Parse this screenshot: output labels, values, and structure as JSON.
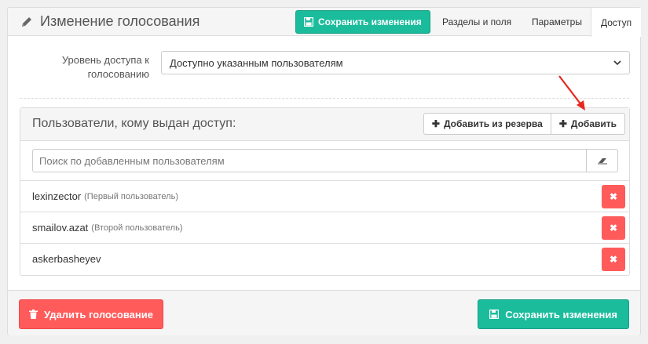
{
  "header": {
    "title": "Изменение голосования",
    "save_label": "Сохранить изменения",
    "tabs": [
      {
        "label": "Разделы и поля"
      },
      {
        "label": "Параметры"
      },
      {
        "label": "Доступ"
      }
    ]
  },
  "access": {
    "label": "Уровень доступа к голосованию",
    "selected": "Доступно указанным пользователям"
  },
  "users_panel": {
    "title": "Пользователи, кому выдан доступ:",
    "add_from_reserve_label": "Добавить из резерва",
    "add_label": "Добавить",
    "search_placeholder": "Поиск по добавленным пользователям",
    "users": [
      {
        "name": "lexinzector",
        "note": "(Первый пользователь)"
      },
      {
        "name": "smailov.azat",
        "note": "(Второй пользователь)"
      },
      {
        "name": "askerbasheyev",
        "note": ""
      }
    ]
  },
  "footer": {
    "delete_label": "Удалить голосование",
    "save_label": "Сохранить изменения"
  },
  "colors": {
    "success": "#1abc9c",
    "danger": "#ff5b5b",
    "annotation_arrow": "#e8281e"
  }
}
